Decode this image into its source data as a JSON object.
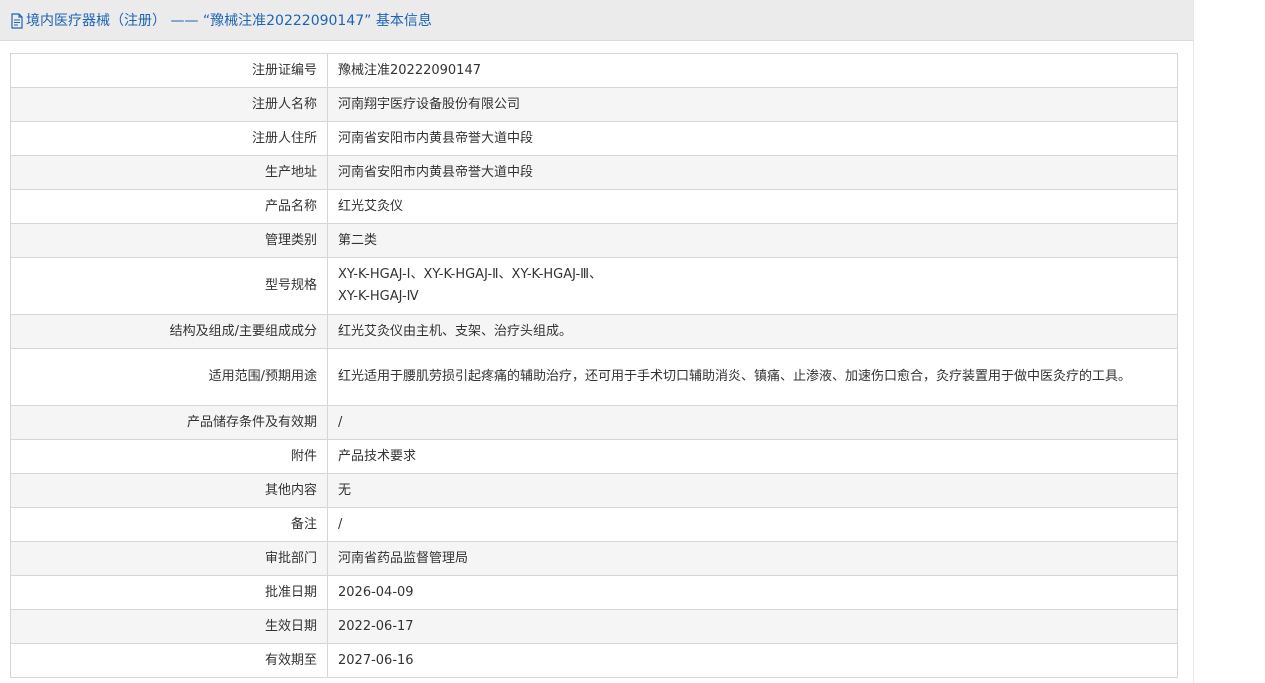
{
  "header": {
    "title": "境内医疗器械（注册） —— “豫械注准20222090147” 基本信息"
  },
  "rows": [
    {
      "label": "注册证编号",
      "value": "豫械注准20222090147"
    },
    {
      "label": "注册人名称",
      "value": "河南翔宇医疗设备股份有限公司"
    },
    {
      "label": "注册人住所",
      "value": "河南省安阳市内黄县帝誉大道中段"
    },
    {
      "label": "生产地址",
      "value": "河南省安阳市内黄县帝誉大道中段"
    },
    {
      "label": "产品名称",
      "value": "红光艾灸仪"
    },
    {
      "label": "管理类别",
      "value": "第二类"
    },
    {
      "label": "型号规格",
      "value": "XY-K-HGAJ-Ⅰ、XY-K-HGAJ-Ⅱ、XY-K-HGAJ-Ⅲ、\nXY-K-HGAJ-Ⅳ"
    },
    {
      "label": "结构及组成/主要组成成分",
      "value": "红光艾灸仪由主机、支架、治疗头组成。"
    },
    {
      "label": "适用范围/预期用途",
      "value": "红光适用于腰肌劳损引起疼痛的辅助治疗，还可用于手术切口辅助消炎、镇痛、止渗液、加速伤口愈合，灸疗装置用于做中医灸疗的工具。"
    },
    {
      "label": "产品储存条件及有效期",
      "value": "/"
    },
    {
      "label": "附件",
      "value": "产品技术要求"
    },
    {
      "label": "其他内容",
      "value": "无"
    },
    {
      "label": "备注",
      "value": "/"
    },
    {
      "label": "审批部门",
      "value": "河南省药品监督管理局"
    },
    {
      "label": "批准日期",
      "value": "2026-04-09"
    },
    {
      "label": "生效日期",
      "value": "2022-06-17"
    },
    {
      "label": "有效期至",
      "value": "2027-06-16"
    }
  ],
  "colors": {
    "header_text": "#1e64b4",
    "header_bg": "#ebebeb",
    "row_alt_bg": "#f5f5f5",
    "border": "#d6d6d6",
    "text": "#333333"
  },
  "icons": {
    "header_icon": "document-icon"
  }
}
